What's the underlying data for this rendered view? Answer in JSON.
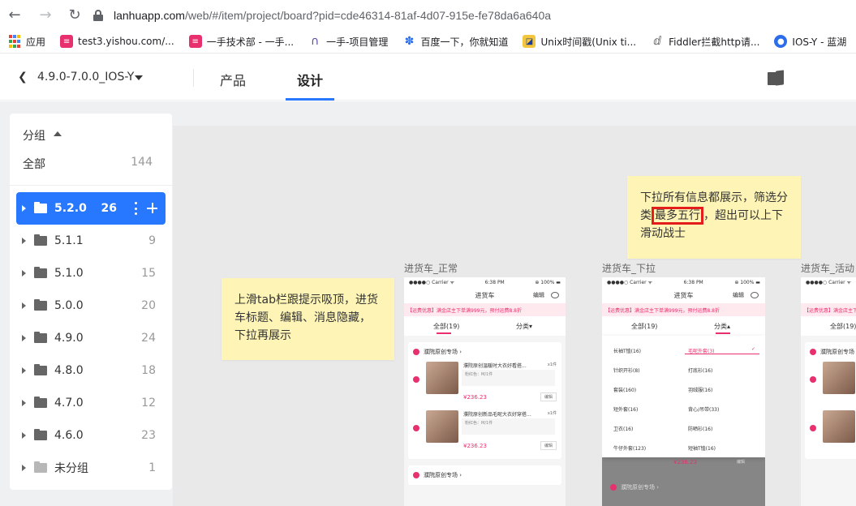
{
  "browser": {
    "url_prefix": "lanhuapp.com",
    "url_rest": "/web/#/item/project/board?pid=cde46314-81af-4d07-915e-fe78da6a640a",
    "bookmarks": [
      {
        "label": "应用",
        "icon": "apps-grid-icon"
      },
      {
        "label": "test3.yishou.com/...",
        "icon": "yishou-icon"
      },
      {
        "label": "一手技术部 - 一手...",
        "icon": "yishou-icon"
      },
      {
        "label": "一手-项目管理",
        "icon": "arch-icon"
      },
      {
        "label": "百度一下，你就知道",
        "icon": "baidu-paw-icon"
      },
      {
        "label": "Unix时间戳(Unix ti...",
        "icon": "unix-icon"
      },
      {
        "label": "Fiddler拦截http请...",
        "icon": "fiddler-icon"
      },
      {
        "label": "IOS-Y - 蓝湖",
        "icon": "lanhu-icon"
      }
    ]
  },
  "header": {
    "project": "4.9.0-7.0.0_IOS-Y",
    "tabs": [
      "产品",
      "设计"
    ]
  },
  "sidebar": {
    "group_title": "分组",
    "all_label": "全部",
    "all_count": "144",
    "groups": [
      {
        "label": "5.2.0",
        "count": "26"
      },
      {
        "label": "5.1.1",
        "count": "9"
      },
      {
        "label": "5.1.0",
        "count": "15"
      },
      {
        "label": "5.0.0",
        "count": "20"
      },
      {
        "label": "4.9.0",
        "count": "24"
      },
      {
        "label": "4.8.0",
        "count": "18"
      },
      {
        "label": "4.7.0",
        "count": "12"
      },
      {
        "label": "4.6.0",
        "count": "23"
      },
      {
        "label": "未分组",
        "count": "1"
      }
    ]
  },
  "notes": {
    "left": "上滑tab栏跟提示吸顶，进货车标题、编辑、消息隐藏，下拉再展示",
    "right_a": "下拉所有信息都展示，筛选分类",
    "right_hl": "最多五行",
    "right_b": "，超出可以上下滑动战士"
  },
  "artboards": {
    "a1": "进货车_正常",
    "a2": "进货车_下拉",
    "a3": "进货车_活动"
  },
  "phone": {
    "carrier": "●●●●○ Carrier ᯤ",
    "time": "6:38 PM",
    "battery": "⊕ 100% ▬",
    "title": "进货车",
    "edit": "编辑",
    "promo": "【运费优惠】满金店主下单满999元，预付运费8.8折",
    "tab_all": "全部(19)",
    "tab_cat": "分类▾",
    "tab_cat_open": "分类▴",
    "shop": "濮院原创专场 ›",
    "item1": "濮院原创温暖时大衣好看搭...",
    "item2": "濮院原创新品毛呢大衣好穿搭...",
    "spec": "粉红色：M/1件",
    "qty": "x1件",
    "price": "¥236.23",
    "btn": "编辑",
    "categories_left": [
      "长袖T恤(16)",
      "针织开衫(8)",
      "套装(160)",
      "短外套(16)",
      "卫衣(16)",
      "牛仔外套(123)"
    ],
    "categories_right": [
      "毛呢外套(3)",
      "打底衫(16)",
      "羽绒服(16)",
      "背心/吊带(33)",
      "防晒衫(16)",
      "短袖T恤(16)"
    ]
  }
}
